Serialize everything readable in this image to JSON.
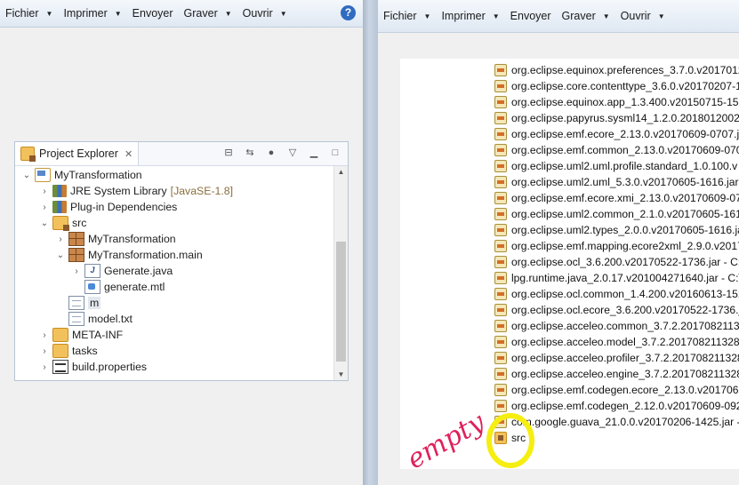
{
  "left_window": {
    "toolbar": {
      "items": [
        {
          "label": "Fichier"
        },
        {
          "label": "Imprimer"
        },
        {
          "label": "Envoyer"
        },
        {
          "label": "Graver"
        },
        {
          "label": "Ouvrir"
        }
      ],
      "help_glyph": "?"
    },
    "project_explorer": {
      "tab_label": "Project Explorer",
      "tab_close": "✕",
      "tree": [
        {
          "id": "project",
          "label": "MyTransformation",
          "icon": "project-icon"
        },
        {
          "id": "jre",
          "label": "JRE System Library",
          "decoration": "[JavaSE-1.8]",
          "icon": "library-icon"
        },
        {
          "id": "plugin-deps",
          "label": "Plug-in Dependencies",
          "icon": "library-icon"
        },
        {
          "id": "src",
          "label": "src",
          "icon": "source-folder-icon"
        },
        {
          "id": "pkg1",
          "label": "MyTransformation",
          "icon": "package-icon"
        },
        {
          "id": "pkg2",
          "label": "MyTransformation.main",
          "icon": "package-icon"
        },
        {
          "id": "generate-java",
          "label": "Generate.java",
          "icon": "java-file-icon"
        },
        {
          "id": "generate-mtl",
          "label": "generate.mtl",
          "icon": "mtl-file-icon"
        },
        {
          "id": "m",
          "label": "m",
          "icon": "text-file-icon"
        },
        {
          "id": "model-txt",
          "label": "model.txt",
          "icon": "text-file-icon"
        },
        {
          "id": "meta-inf",
          "label": "META-INF",
          "icon": "folder-icon"
        },
        {
          "id": "tasks",
          "label": "tasks",
          "icon": "folder-icon"
        },
        {
          "id": "build-props",
          "label": "build.properties",
          "icon": "properties-file-icon"
        }
      ]
    }
  },
  "right_window": {
    "toolbar": {
      "items": [
        {
          "label": "Fichier"
        },
        {
          "label": "Imprimer"
        },
        {
          "label": "Envoyer"
        },
        {
          "label": "Graver"
        },
        {
          "label": "Ouvrir"
        }
      ]
    },
    "files": [
      "org.eclipse.equinox.preferences_3.7.0.v2017012",
      "org.eclipse.core.contenttype_3.6.0.v20170207-1",
      "org.eclipse.equinox.app_1.3.400.v20150715-152",
      "org.eclipse.papyrus.sysml14_1.2.0.20180120022",
      "org.eclipse.emf.ecore_2.13.0.v20170609-0707.ja",
      "org.eclipse.emf.common_2.13.0.v20170609-070",
      "org.eclipse.uml2.uml.profile.standard_1.0.100.v",
      "org.eclipse.uml2.uml_5.3.0.v20170605-1616.jar",
      "org.eclipse.emf.ecore.xmi_2.13.0.v20170609-070",
      "org.eclipse.uml2.common_2.1.0.v20170605-161",
      "org.eclipse.uml2.types_2.0.0.v20170605-1616.ja",
      "org.eclipse.emf.mapping.ecore2xml_2.9.0.v2017",
      "org.eclipse.ocl_3.6.200.v20170522-1736.jar - C:\\",
      "lpg.runtime.java_2.0.17.v201004271640.jar - C:\\",
      "org.eclipse.ocl.common_1.4.200.v20160613-151",
      "org.eclipse.ocl.ecore_3.6.200.v20170522-1736.ja",
      "org.eclipse.acceleo.common_3.7.2.2017082113",
      "org.eclipse.acceleo.model_3.7.2.201708211328.j",
      "org.eclipse.acceleo.profiler_3.7.2.201708211328",
      "org.eclipse.acceleo.engine_3.7.2.201708211328.",
      "org.eclipse.emf.codegen.ecore_2.13.0.v2017060",
      "org.eclipse.emf.codegen_2.12.0.v20170609-0928",
      "com.google.guava_21.0.0.v20170206-1425.jar -"
    ],
    "src_label": "src",
    "annotation": {
      "text": "empty",
      "color": "#e0205a",
      "highlight_color": "#f5ee10"
    }
  }
}
